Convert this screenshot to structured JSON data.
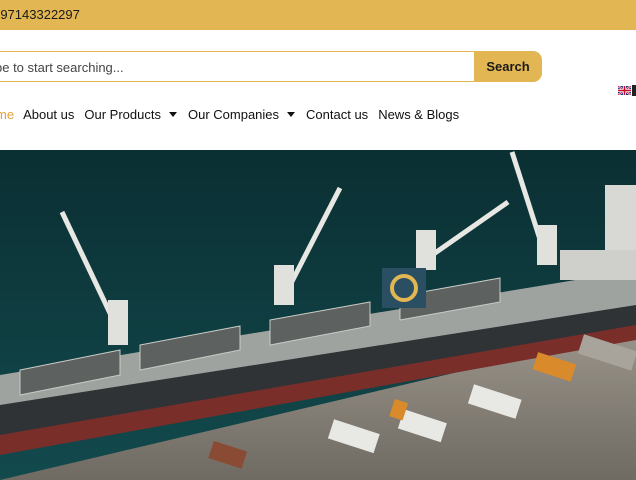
{
  "topbar": {
    "phone": "-97143322297"
  },
  "search": {
    "placeholder": "pe to start searching...",
    "button_label": "Search"
  },
  "nav": {
    "items": [
      {
        "label": "me",
        "active": true,
        "dropdown": false
      },
      {
        "label": "About us",
        "dropdown": false
      },
      {
        "label": "Our Products",
        "dropdown": true
      },
      {
        "label": "Our Companies",
        "dropdown": true
      },
      {
        "label": "Contact us",
        "dropdown": false
      },
      {
        "label": "News & Blogs",
        "dropdown": false
      }
    ]
  },
  "language": {
    "icon": "uk-flag-icon"
  },
  "colors": {
    "accent": "#e2b652",
    "active_nav": "#e2a23b",
    "sea": "#0e3b3f",
    "hull": "#3b3b3b"
  },
  "hero": {
    "description_icon": "ship-port-photo"
  }
}
